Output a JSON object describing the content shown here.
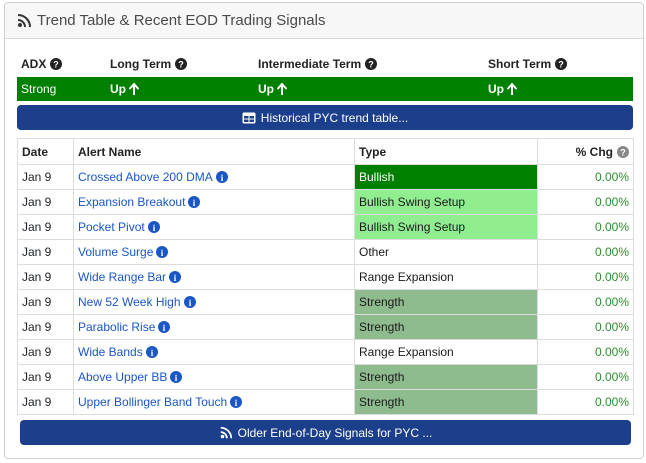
{
  "header": {
    "title": "Trend Table & Recent EOD Trading Signals"
  },
  "trend": {
    "columns": [
      "ADX",
      "Long Term",
      "Intermediate Term",
      "Short Term"
    ],
    "values": [
      "Strong",
      "Up",
      "Up",
      "Up"
    ]
  },
  "buttons": {
    "historical": "Historical PYC trend table...",
    "older": "Older End-of-Day Signals for PYC ..."
  },
  "table": {
    "headers": [
      "Date",
      "Alert Name",
      "Type",
      "% Chg"
    ],
    "rows": [
      {
        "date": "Jan 9",
        "alert": "Crossed Above 200 DMA",
        "type": "Bullish",
        "chg": "0.00%"
      },
      {
        "date": "Jan 9",
        "alert": "Expansion Breakout",
        "type": "Bullish Swing Setup",
        "chg": "0.00%"
      },
      {
        "date": "Jan 9",
        "alert": "Pocket Pivot",
        "type": "Bullish Swing Setup",
        "chg": "0.00%"
      },
      {
        "date": "Jan 9",
        "alert": "Volume Surge",
        "type": "Other",
        "chg": "0.00%"
      },
      {
        "date": "Jan 9",
        "alert": "Wide Range Bar",
        "type": "Range Expansion",
        "chg": "0.00%"
      },
      {
        "date": "Jan 9",
        "alert": "New 52 Week High",
        "type": "Strength",
        "chg": "0.00%"
      },
      {
        "date": "Jan 9",
        "alert": "Parabolic Rise",
        "type": "Strength",
        "chg": "0.00%"
      },
      {
        "date": "Jan 9",
        "alert": "Wide Bands",
        "type": "Range Expansion",
        "chg": "0.00%"
      },
      {
        "date": "Jan 9",
        "alert": "Above Upper BB",
        "type": "Strength",
        "chg": "0.00%"
      },
      {
        "date": "Jan 9",
        "alert": "Upper Bollinger Band Touch",
        "type": "Strength",
        "chg": "0.00%"
      }
    ]
  },
  "colors": {
    "trend_row": "#008000",
    "button": "#1c3f8c",
    "bullish": "#008000",
    "bullish_swing_setup": "#90ee90",
    "strength": "#8fbc8f",
    "link": "#1a56c4",
    "positive_change": "#2e8b2e"
  },
  "icons": {
    "header": "signal-icon",
    "help": "question-circle-icon",
    "up": "arrow-up-icon",
    "info": "info-circle-icon",
    "table": "table-icon"
  }
}
